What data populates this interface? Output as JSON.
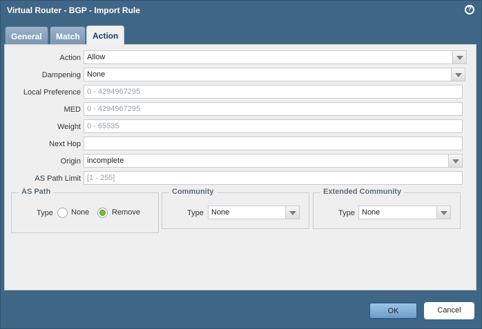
{
  "window": {
    "title": "Virtual Router - BGP - Import Rule",
    "help_label": "?"
  },
  "tabs": [
    {
      "label": "General"
    },
    {
      "label": "Match"
    },
    {
      "label": "Action"
    }
  ],
  "form": {
    "action_label": "Action",
    "action_value": "Allow",
    "dampening_label": "Dampening",
    "dampening_value": "None",
    "local_pref_label": "Local Preference",
    "local_pref_placeholder": "0 - 4294967295",
    "med_label": "MED",
    "med_placeholder": "0 - 4294967295",
    "weight_label": "Weight",
    "weight_placeholder": "0 - 65535",
    "nexthop_label": "Next Hop",
    "nexthop_value": "",
    "origin_label": "Origin",
    "origin_value": "incomplete",
    "aspath_limit_label": "AS Path Limit",
    "aspath_limit_placeholder": "[1 - 255]"
  },
  "as_path": {
    "title": "AS Path",
    "type_label": "Type",
    "none_label": "None",
    "remove_label": "Remove"
  },
  "community": {
    "title": "Community",
    "type_label": "Type",
    "value": "None"
  },
  "extended_community": {
    "title": "Extended Community",
    "type_label": "Type",
    "value": "None"
  },
  "footer": {
    "ok_label": "OK",
    "cancel_label": "Cancel"
  }
}
